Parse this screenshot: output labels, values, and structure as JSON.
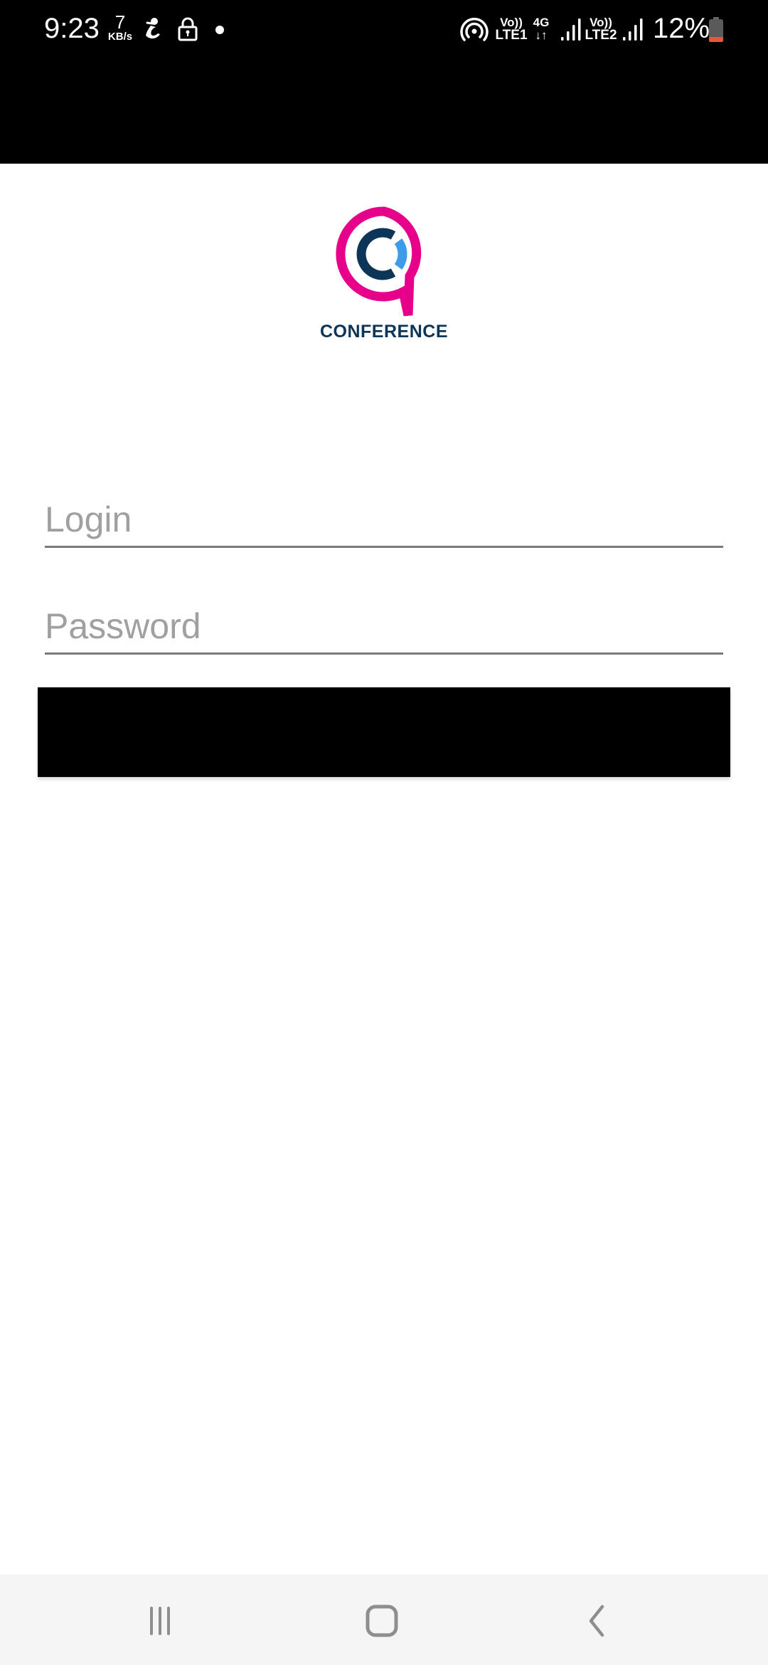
{
  "status_bar": {
    "time": "9:23",
    "net_speed_value": "7",
    "net_speed_unit": "KB/s",
    "sim1_top": "Vo))",
    "sim1_bottom": "LTE1",
    "data_type": "4G",
    "data_arrows": "↓↑",
    "sim2_top": "Vo))",
    "sim2_bottom": "LTE2",
    "battery_percent": "12%",
    "icons": [
      "samsung-health-icon",
      "lock-icon",
      "notification-dot-icon",
      "hotspot-icon",
      "signal-icon",
      "battery-icon"
    ],
    "battery_level_color": "#e8573a"
  },
  "app": {
    "logo_text": "CONFERENCE",
    "brand_colors": {
      "pink": "#e6008a",
      "navy": "#0c3557",
      "blue": "#3d9be9"
    }
  },
  "form": {
    "login": {
      "placeholder": "Login",
      "value": ""
    },
    "password": {
      "placeholder": "Password",
      "value": ""
    },
    "submit_label": ""
  },
  "nav_bar": {
    "recents_label": "Recent apps",
    "home_label": "Home",
    "back_label": "Back"
  }
}
